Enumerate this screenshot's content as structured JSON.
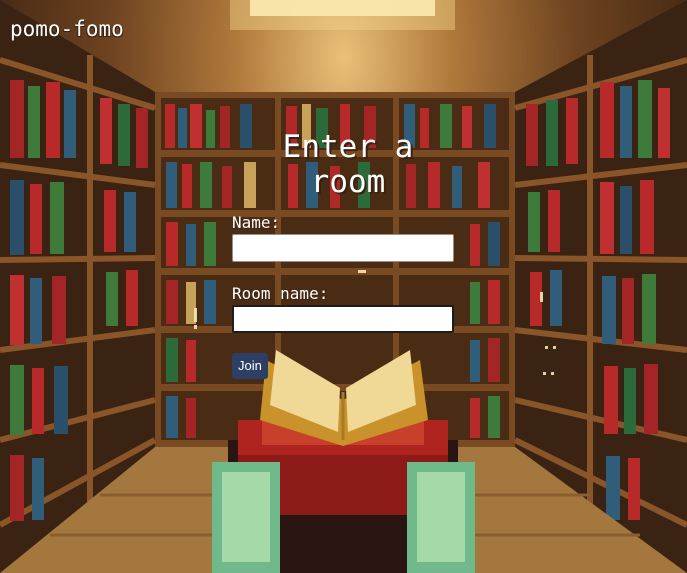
{
  "app": {
    "brand": "pomo-fomo"
  },
  "form": {
    "title": "Enter a room",
    "name_label": "Name:",
    "name_value": "",
    "room_label": "Room name:",
    "room_value": "",
    "join_label": "Join"
  },
  "background": {
    "scene": "pixel-art library with bookshelves and enchanting table with open book"
  }
}
